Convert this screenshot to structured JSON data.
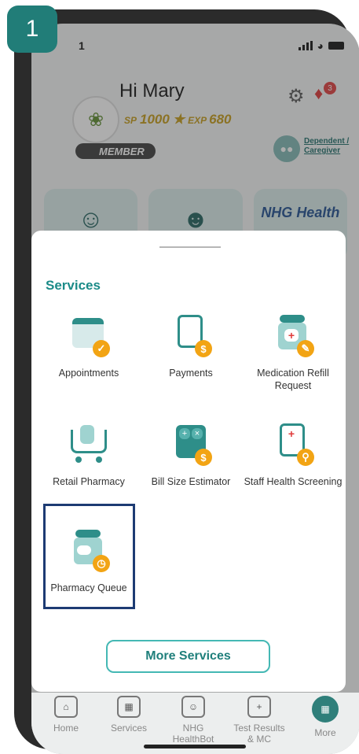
{
  "step_label": "1",
  "status_bar": {
    "time": "1"
  },
  "header": {
    "greeting": "Hi Mary",
    "sp_label": "SP",
    "points": "1000",
    "exp_label": "EXP",
    "exp_value": "680",
    "member_label": "MEMBER",
    "notification_count": "3",
    "dependent_label": "Dependent / Caregiver"
  },
  "tiles": [
    {
      "label": "NHG Health"
    }
  ],
  "sheet": {
    "title": "Services",
    "services": [
      {
        "label": "Appointments"
      },
      {
        "label": "Payments"
      },
      {
        "label": "Medication Refill Request"
      },
      {
        "label": "Retail Pharmacy"
      },
      {
        "label": "Bill Size Estimator"
      },
      {
        "label": "Staff Health Screening"
      },
      {
        "label": "Pharmacy Queue"
      }
    ],
    "more_button": "More Services"
  },
  "tabbar": [
    {
      "label": "Home"
    },
    {
      "label": "Services"
    },
    {
      "label": "NHG HealthBot"
    },
    {
      "label": "Test Results & MC"
    },
    {
      "label": "More"
    }
  ],
  "colors": {
    "accent": "#2f7f7a",
    "highlight_border": "#1d3b73",
    "badge": "#f2a414"
  }
}
